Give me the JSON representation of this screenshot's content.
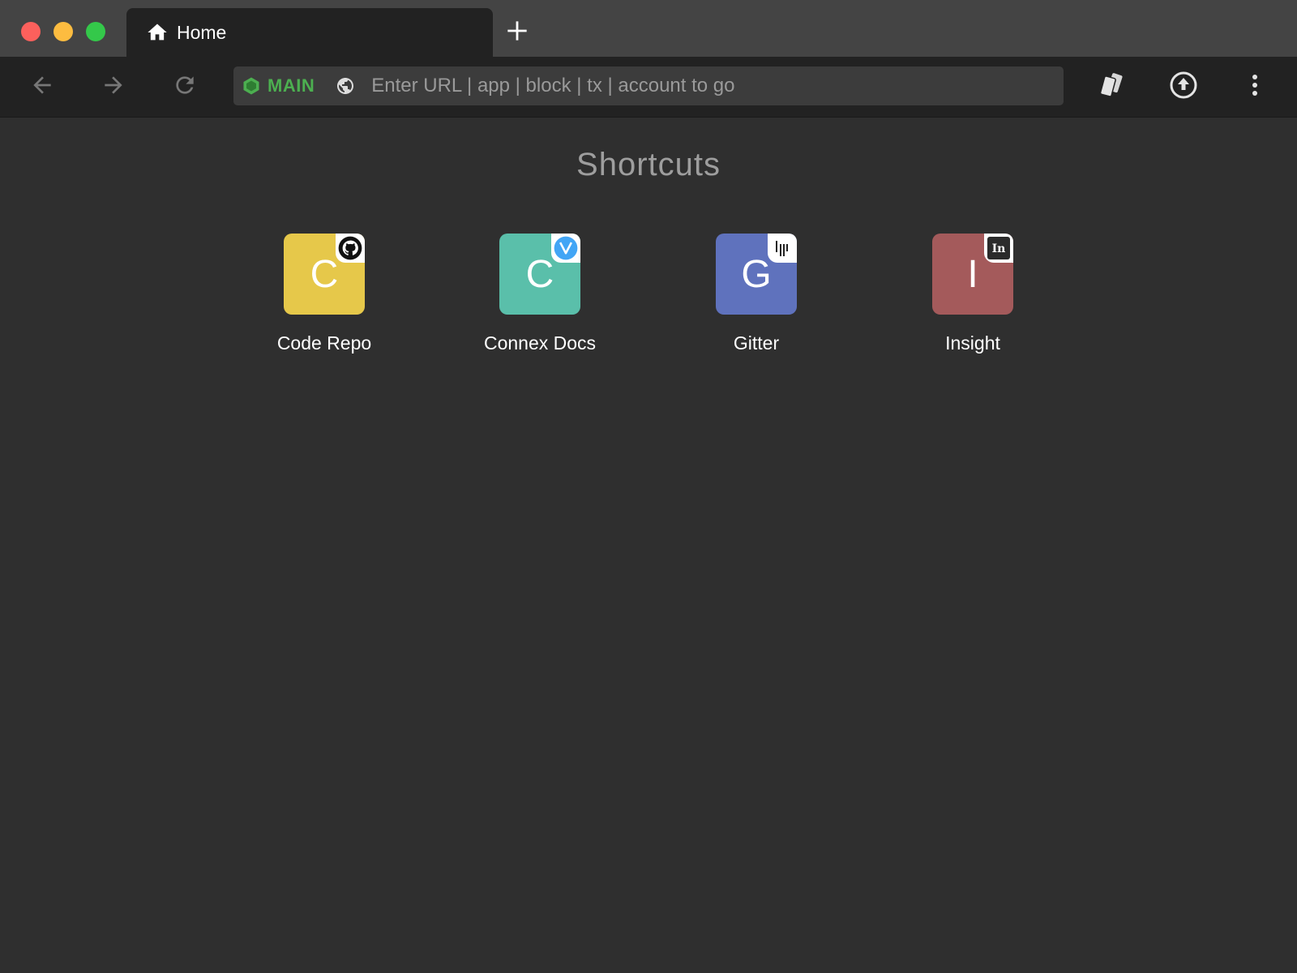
{
  "window": {
    "controls": [
      "close",
      "minimize",
      "maximize"
    ]
  },
  "tabs": [
    {
      "label": "Home",
      "icon": "home-icon",
      "active": true
    }
  ],
  "new_tab_icon": "plus-icon",
  "toolbar": {
    "back_icon": "back-arrow-icon",
    "forward_icon": "forward-arrow-icon",
    "reload_icon": "reload-icon",
    "network": {
      "label": "MAIN",
      "color": "#4caf50",
      "icon": "hexagon-icon"
    },
    "address": {
      "placeholder": "Enter URL | app | block | tx | account to go",
      "value": "",
      "icon": "globe-icon"
    },
    "actions": [
      "wallet-cards-icon",
      "upload-circle-icon",
      "more-vert-icon"
    ]
  },
  "main": {
    "title": "Shortcuts",
    "shortcuts": [
      {
        "letter": "C",
        "label": "Code Repo",
        "color": "#e6c84a",
        "badge": "github-icon"
      },
      {
        "letter": "C",
        "label": "Connex Docs",
        "color": "#5abfaa",
        "badge": "vuejs-icon"
      },
      {
        "letter": "G",
        "label": "Gitter",
        "color": "#5f72bd",
        "badge": "gitter-icon"
      },
      {
        "letter": "I",
        "label": "Insight",
        "color": "#a45a5b",
        "badge": "insight-icon"
      }
    ]
  }
}
